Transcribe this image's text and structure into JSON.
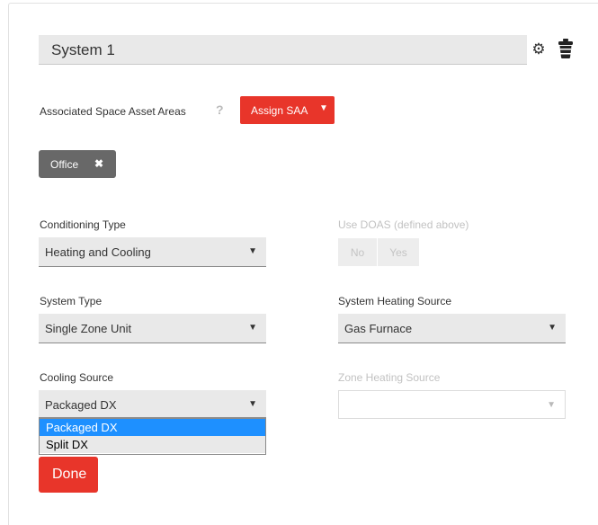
{
  "system": {
    "title": "System 1"
  },
  "icons": {
    "settings": "gear-icon",
    "delete": "trash-icon"
  },
  "saa": {
    "label": "Associated Space Asset Areas",
    "help": "?",
    "assign_label": "Assign SAA",
    "caret": "▼",
    "chips": [
      {
        "label": "Office",
        "remove": "✖"
      }
    ]
  },
  "conditioning": {
    "label": "Conditioning Type",
    "value": "Heating and Cooling",
    "arrow": "▼"
  },
  "doas": {
    "label": "Use DOAS (defined above)",
    "options": [
      "No",
      "Yes"
    ]
  },
  "system_type": {
    "label": "System Type",
    "value": "Single Zone Unit",
    "arrow": "▼"
  },
  "heating_source": {
    "label": "System Heating Source",
    "value": "Gas Furnace",
    "arrow": "▼"
  },
  "cooling": {
    "label": "Cooling Source",
    "value": "Packaged DX",
    "arrow": "▼",
    "options": [
      "Packaged DX",
      "Split DX"
    ]
  },
  "zone_heating": {
    "label": "Zone Heating Source",
    "value": "",
    "arrow": "▼"
  },
  "done_label": "Done",
  "colors": {
    "accent": "#e8352a",
    "chip": "#686868",
    "selected_option": "#1e90ff"
  }
}
